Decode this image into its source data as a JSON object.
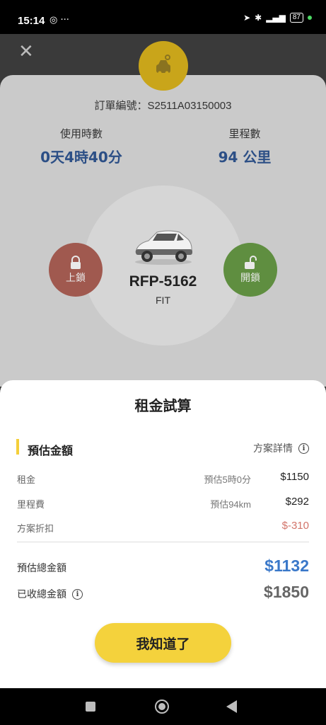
{
  "status_bar": {
    "time": "15:14",
    "left_icons": "◎ ···",
    "battery": "87"
  },
  "vehicle": {
    "order_number": "訂單編號：S2511A03150003",
    "usage_label": "使用時數",
    "usage_value": "0天4時40分",
    "mileage_label": "里程數",
    "mileage_value": "94 公里",
    "lock_label": "上鎖",
    "unlock_label": "開鎖",
    "plate": "RFP-5162",
    "model": "FIT"
  },
  "sheet": {
    "title": "租金試算",
    "section_title": "預估金額",
    "plan_detail": "方案詳情",
    "rows": [
      {
        "label": "租金",
        "note": "預估5時0分",
        "value": "$1150"
      },
      {
        "label": "里程費",
        "note": "預估94km",
        "value": "$292"
      },
      {
        "label": "方案折扣",
        "note": "",
        "value": "$-310"
      }
    ],
    "estimated_total_label": "預估總金額",
    "estimated_total_value": "$1132",
    "collected_total_label": "已收總金額",
    "collected_total_value": "$1850",
    "ok_button": "我知道了"
  },
  "colors": {
    "accent_yellow": "#f4d23c",
    "total_blue": "#3a78c9",
    "discount_red": "#d2746a",
    "lock_red": "#a0594f",
    "unlock_green": "#5f8e40"
  }
}
